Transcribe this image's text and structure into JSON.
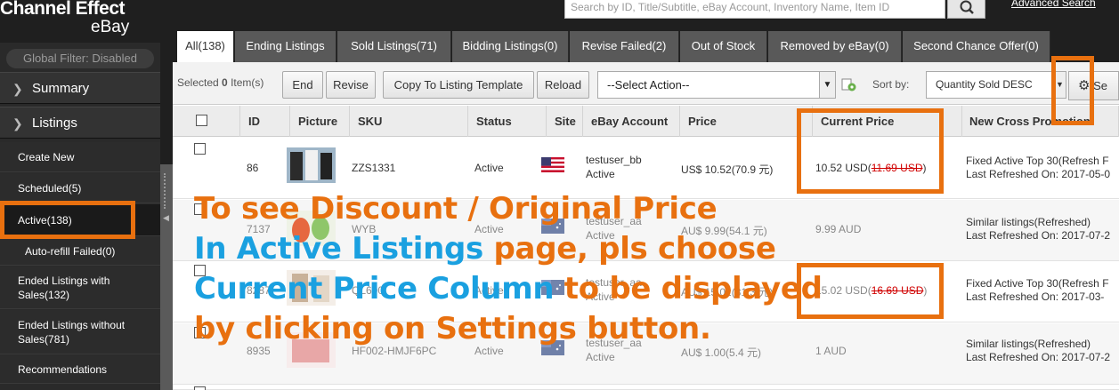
{
  "header": {
    "logo_line1": "Channel Effect",
    "logo_line2": "eBay",
    "search_placeholder": "Search by ID, Title/Subtitle, eBay Account, Inventory Name, Item ID",
    "advanced_search": "Advanced Search"
  },
  "sidebar": {
    "global_filter": "Global Filter: Disabled",
    "sections": [
      {
        "label": "Summary"
      },
      {
        "label": "Listings"
      }
    ],
    "items": [
      {
        "label": "Create New"
      },
      {
        "label": "Scheduled(5)"
      },
      {
        "label": "Active(138)"
      },
      {
        "label": "Auto-refill Failed(0)"
      },
      {
        "label": "Ended Listings with Sales(132)"
      },
      {
        "label": "Ended Listings without Sales(781)"
      },
      {
        "label": "Recommendations"
      }
    ]
  },
  "tabs": [
    {
      "label": "All(138)"
    },
    {
      "label": "Ending Listings"
    },
    {
      "label": "Sold Listings(71)"
    },
    {
      "label": "Bidding Listings(0)"
    },
    {
      "label": "Revise Failed(2)"
    },
    {
      "label": "Out of Stock"
    },
    {
      "label": "Removed by eBay(0)"
    },
    {
      "label": "Second Chance Offer(0)"
    }
  ],
  "toolbar": {
    "selected_prefix": "Selected ",
    "selected_count": "0",
    "selected_suffix": " Item(s)",
    "end": "End",
    "revise": "Revise",
    "copy_template": "Copy To Listing Template",
    "reload": "Reload",
    "action_select": "--Select Action--",
    "sort_by": "Sort by:",
    "sort_value": "Quantity Sold DESC",
    "settings": "Se"
  },
  "table": {
    "columns": [
      "ID",
      "Picture",
      "SKU",
      "Status",
      "Site",
      "eBay Account",
      "Price",
      "Current Price",
      "New Cross Promotion"
    ],
    "rows": [
      {
        "id": "86",
        "sku": "ZZS1331",
        "status": "Active",
        "site": "us",
        "account": "testuser_bb",
        "account_status": "Active",
        "price": "US$ 10.52(70.9 元)",
        "current_price": "10.52 USD(",
        "original_price": "11.69 USD",
        "current_price_end": ")",
        "promo1": "Fixed Active Top 30(Refresh F",
        "promo2": "Last Refreshed On: 2017-05-0"
      },
      {
        "id": "7137",
        "sku": "WYB",
        "status": "Active",
        "site": "au",
        "account": "testuser_aa",
        "account_status": "Active",
        "price": "AU$ 9.99(54.1 元)",
        "current_price": "9.99 AUD",
        "original_price": "",
        "current_price_end": "",
        "promo1": "Similar listings(Refreshed)",
        "promo2": "Last Refreshed On: 2017-07-2"
      },
      {
        "id": "8287",
        "sku": "QL600",
        "status": "Active",
        "site": "au",
        "account": "testuser_aa",
        "account_status": "Active",
        "price": "AU$ 15.02(81.3 元)",
        "current_price": "15.02 USD(",
        "original_price": "16.69 USD",
        "current_price_end": ")",
        "promo1": "Fixed Active Top 30(Refresh F",
        "promo2": "Last Refreshed On: 2017-03-"
      },
      {
        "id": "8935",
        "sku": "HF002-HMJF6PC",
        "status": "Active",
        "site": "au",
        "account": "testuser_aa",
        "account_status": "Active",
        "price": "AU$ 1.00(5.4 元)",
        "current_price": "1 AUD",
        "original_price": "",
        "current_price_end": "",
        "promo1": "Similar listings(Refreshed)",
        "promo2": "Last Refreshed On: 2017-07-2"
      }
    ]
  },
  "overlay": {
    "line1": "To see Discount / Original Price",
    "line2a": "In Active Listings",
    "line2b": " page, pls choose",
    "line3a": "Current Price Column",
    "line3b": " to be displayed",
    "line4a": "by clicking on ",
    "line4b": "Settings button."
  },
  "colors": {
    "annotation_orange": "#e8700f",
    "annotation_blue": "#1aa0e0",
    "strike_red": "#d00000"
  }
}
